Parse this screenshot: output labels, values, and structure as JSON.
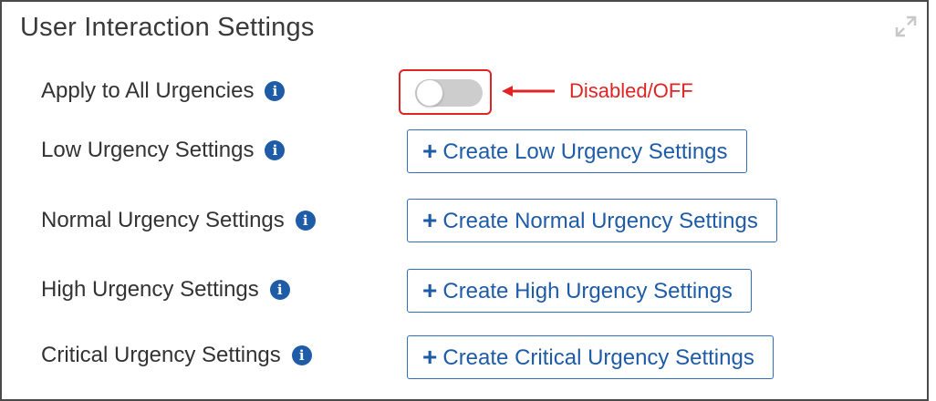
{
  "panel": {
    "title": "User Interaction Settings"
  },
  "apply_all": {
    "label": "Apply to All Urgencies",
    "info_glyph": "i",
    "toggle_state": "off"
  },
  "annotation": {
    "text": "Disabled/OFF",
    "color": "#e02424"
  },
  "rows": [
    {
      "label": "Low Urgency Settings",
      "info_glyph": "i",
      "button_plus": "+",
      "button_label": "Create Low Urgency Settings"
    },
    {
      "label": "Normal Urgency Settings",
      "info_glyph": "i",
      "button_plus": "+",
      "button_label": "Create Normal Urgency Settings"
    },
    {
      "label": "High Urgency Settings",
      "info_glyph": "i",
      "button_plus": "+",
      "button_label": "Create High Urgency Settings"
    },
    {
      "label": "Critical Urgency Settings",
      "info_glyph": "i",
      "button_plus": "+",
      "button_label": "Create Critical Urgency Settings"
    }
  ],
  "colors": {
    "accent": "#1f5ca8",
    "toggle_off": "#cdcdcd",
    "highlight": "#e02424"
  },
  "icons": {
    "expand": "expand-icon",
    "info": "info-icon",
    "arrow": "arrow-left-icon",
    "plus": "plus-icon"
  }
}
